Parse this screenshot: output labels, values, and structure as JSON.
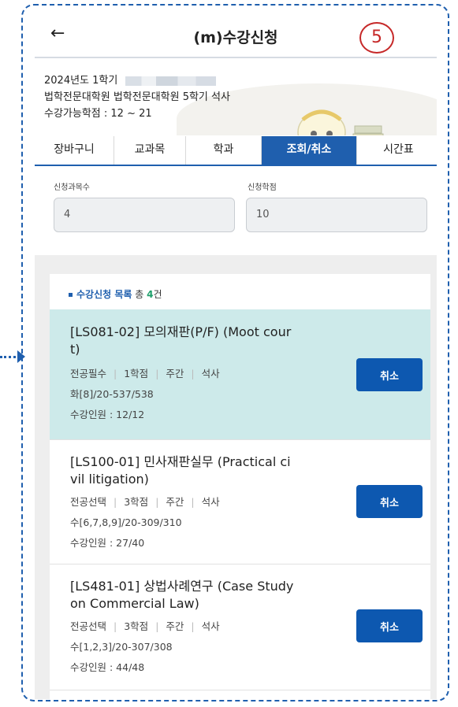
{
  "header": {
    "back_icon": "←",
    "title": "(m)수강신청",
    "step_number": "5"
  },
  "info": {
    "term": "2024년도 1학기",
    "program": "법학전문대학원 법학전문대학원 5학기 석사",
    "credit_range": "수강가능학점 : 12 ~ 21"
  },
  "tabs": [
    {
      "label": "장바구니",
      "active": false
    },
    {
      "label": "교과목",
      "active": false
    },
    {
      "label": "학과",
      "active": false
    },
    {
      "label": "조회/취소",
      "active": true
    },
    {
      "label": "시간표",
      "active": false
    }
  ],
  "summary": {
    "courses_label": "신청과목수",
    "courses_value": "4",
    "credits_label": "신청학점",
    "credits_value": "10"
  },
  "list": {
    "title": "수강신청 목록",
    "total_prefix": "총",
    "count": "4",
    "count_suffix": "건"
  },
  "courses": [
    {
      "title_line1": "[LS081-02] 모의재판(P/F) (Moot cour",
      "title_line2": "t)",
      "type": "전공필수",
      "credits": "1학점",
      "session": "주간",
      "degree": "석사",
      "schedule": "화[8]/20-537/538",
      "enrollment": "수강인원 : 12/12",
      "button": "취소",
      "selected": true
    },
    {
      "title_line1": "[LS100-01] 민사재판실무 (Practical ci",
      "title_line2": "vil litigation)",
      "type": "전공선택",
      "credits": "3학점",
      "session": "주간",
      "degree": "석사",
      "schedule": "수[6,7,8,9]/20-309/310",
      "enrollment": "수강인원 : 27/40",
      "button": "취소",
      "selected": false
    },
    {
      "title_line1": "[LS481-01] 상법사례연구 (Case Study",
      "title_line2": "on Commercial Law)",
      "type": "전공선택",
      "credits": "3학점",
      "session": "주간",
      "degree": "석사",
      "schedule": "수[1,2,3]/20-307/308",
      "enrollment": "수강인원 : 44/48",
      "button": "취소",
      "selected": false
    }
  ],
  "colors": {
    "frame": "#1f5fae",
    "accent": "#1f5fae",
    "button": "#0d58b0",
    "selected_row": "#cdeaea",
    "badge": "#c62828",
    "count": "#1e9e6a"
  }
}
